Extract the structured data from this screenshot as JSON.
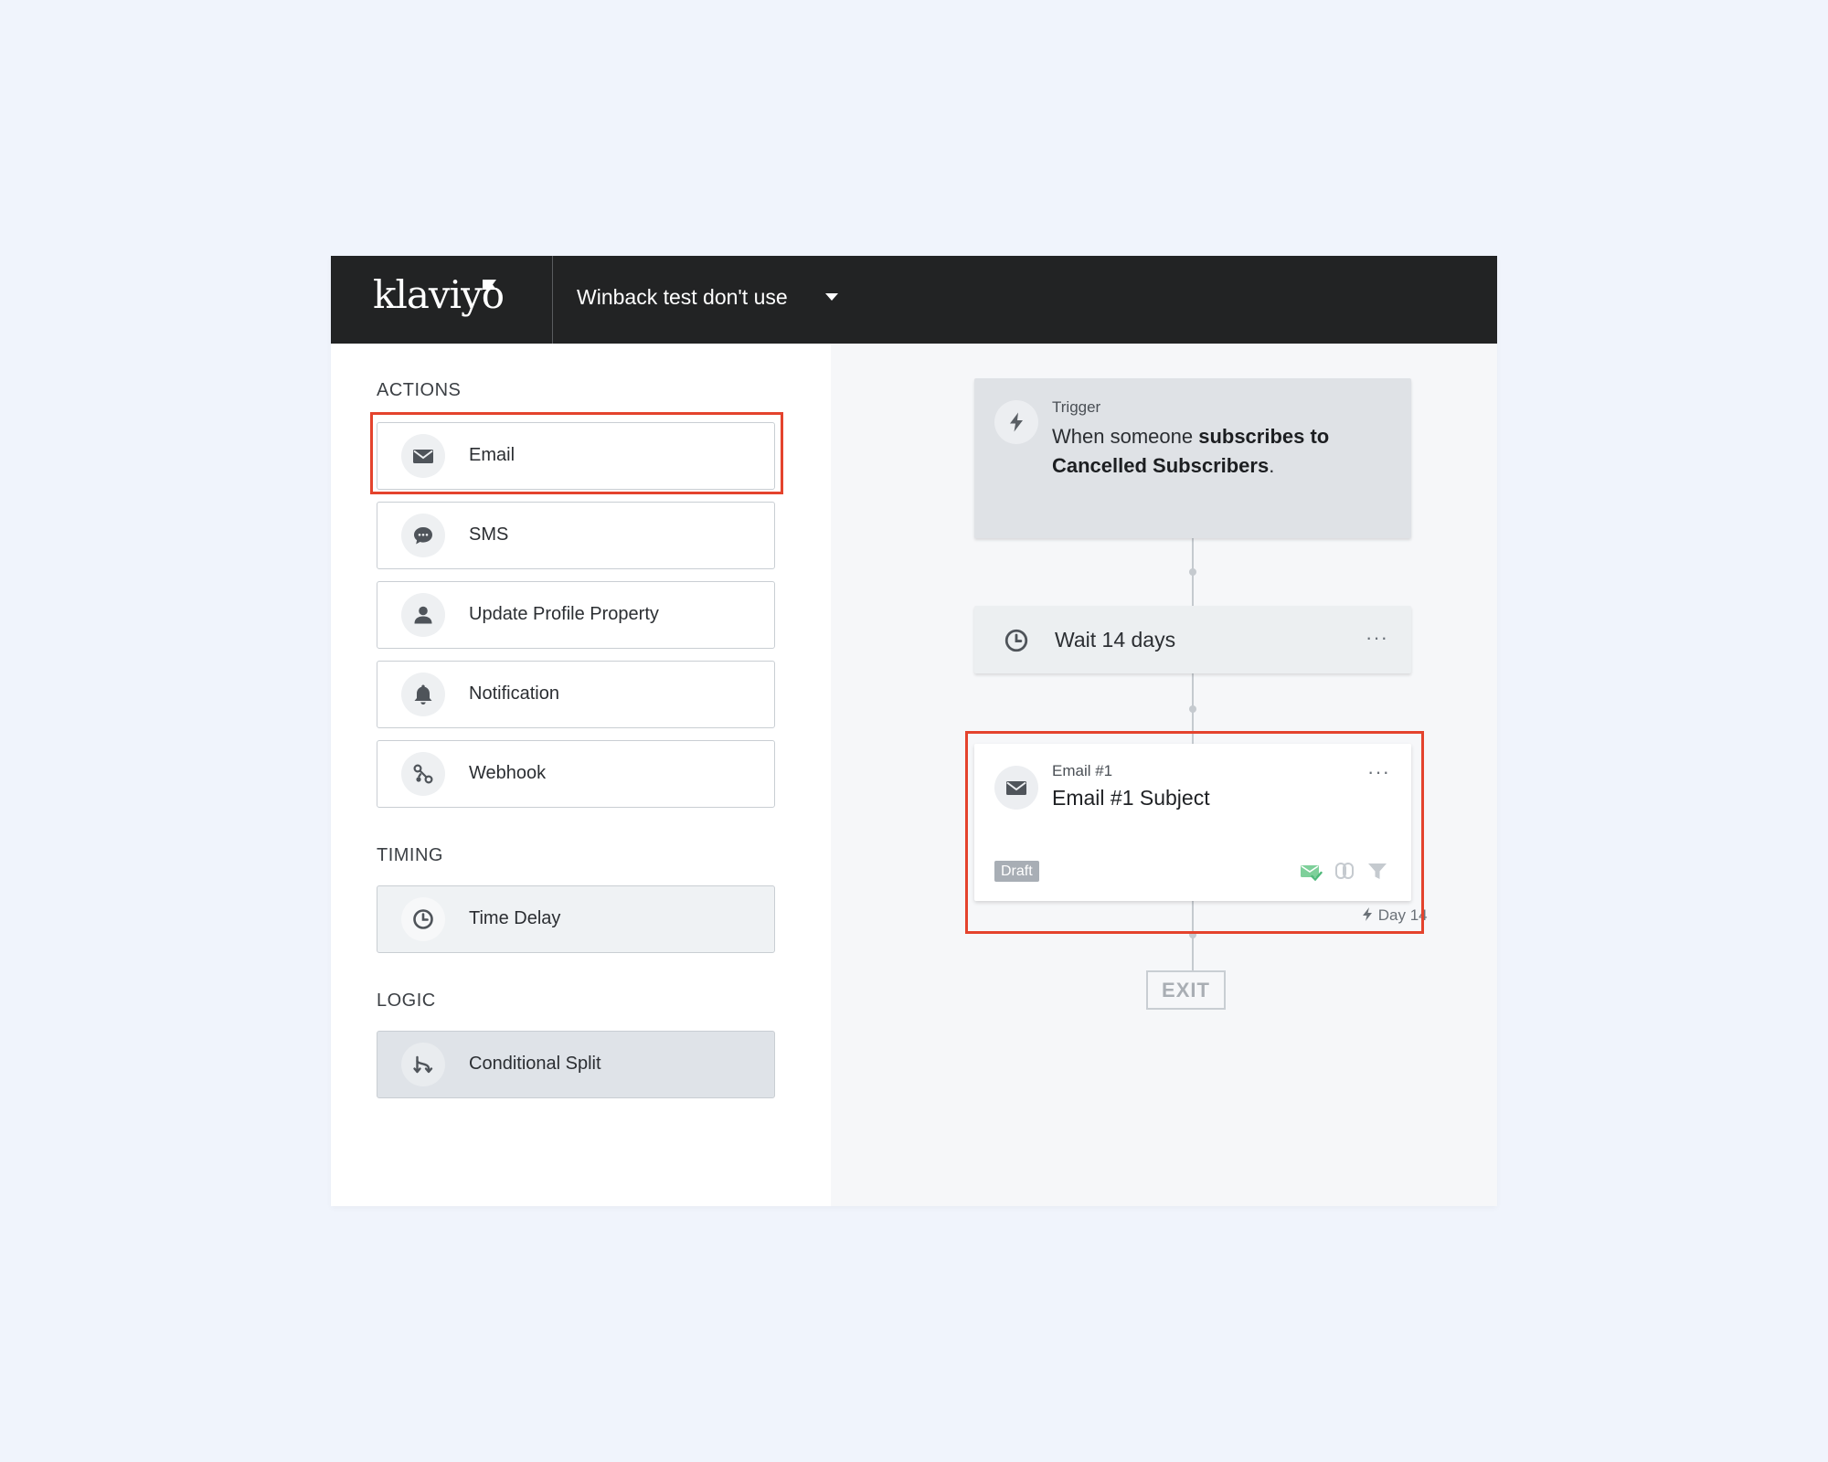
{
  "header": {
    "brand": "klaviyo",
    "flow_name": "Winback test don't use"
  },
  "sidebar": {
    "actions_title": "ACTIONS",
    "actions": [
      {
        "label": "Email",
        "icon": "envelope-icon"
      },
      {
        "label": "SMS",
        "icon": "chat-bubble-icon"
      },
      {
        "label": "Update Profile Property",
        "icon": "person-icon"
      },
      {
        "label": "Notification",
        "icon": "bell-icon"
      },
      {
        "label": "Webhook",
        "icon": "webhook-icon"
      }
    ],
    "timing_title": "TIMING",
    "timing": [
      {
        "label": "Time Delay",
        "icon": "clock-icon"
      }
    ],
    "logic_title": "LOGIC",
    "logic": [
      {
        "label": "Conditional Split",
        "icon": "split-icon"
      }
    ]
  },
  "canvas": {
    "trigger": {
      "kicker": "Trigger",
      "text_prefix": "When someone ",
      "text_bold": "subscribes to Cancelled Subscribers",
      "text_suffix": "."
    },
    "wait": {
      "label": "Wait 14 days",
      "more": "···"
    },
    "email": {
      "kicker": "Email #1",
      "subject": "Email #1 Subject",
      "status": "Draft",
      "more": "···",
      "day_label": "Day 14"
    },
    "exit_label": "EXIT"
  },
  "colors": {
    "highlight": "#e4432d",
    "topbar": "#222324",
    "page_background": "#f0f4fc",
    "status_green": "#7ed09a"
  }
}
